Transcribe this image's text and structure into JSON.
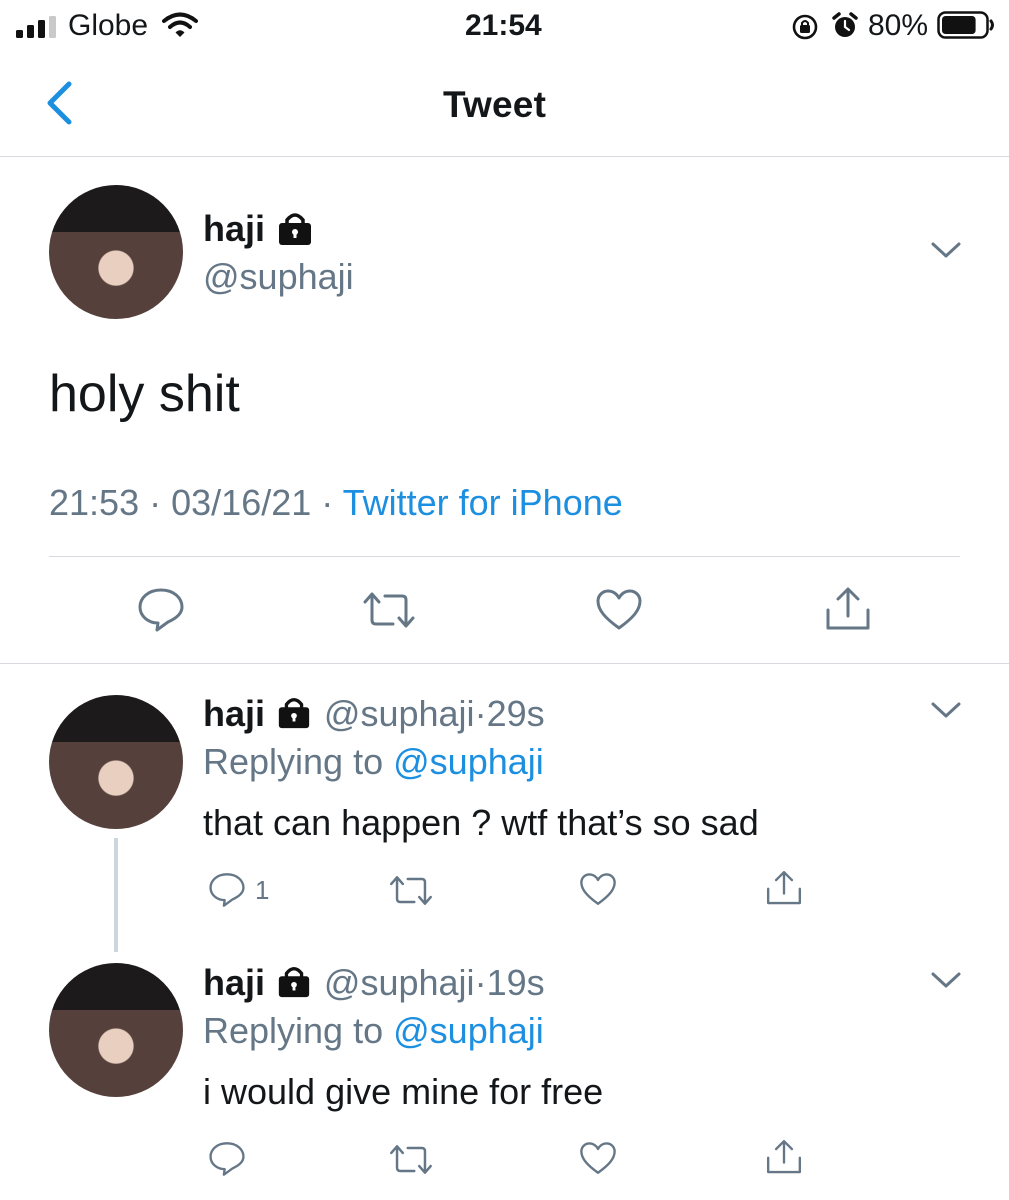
{
  "status_bar": {
    "carrier": "Globe",
    "time": "21:54",
    "battery_pct": "80%",
    "battery_level": 0.8
  },
  "nav": {
    "title": "Tweet"
  },
  "main_tweet": {
    "name": "haji",
    "handle": "@suphaji",
    "text": "holy shit",
    "time": "21:53",
    "sep1": "·",
    "date": "03/16/21",
    "sep2": "·",
    "source": "Twitter for iPhone"
  },
  "replies": [
    {
      "name": "haji",
      "handle": "@suphaji",
      "dot": "·",
      "age": "29s",
      "replying_prefix": "Replying to",
      "replying_to": "@suphaji",
      "text": "that can happen ? wtf that’s so sad",
      "reply_count": "1"
    },
    {
      "name": "haji",
      "handle": "@suphaji",
      "dot": "·",
      "age": "19s",
      "replying_prefix": "Replying to",
      "replying_to": "@suphaji",
      "text": "i would give mine for free",
      "reply_count": ""
    }
  ],
  "colors": {
    "link": "#1d8fe0",
    "muted": "#657786",
    "text": "#14171a",
    "divider": "#d6dadf",
    "thread_line": "#ccd6dd"
  },
  "icons": [
    "signal-icon",
    "wifi-icon",
    "orientation-lock-icon",
    "alarm-icon",
    "battery-icon",
    "back-chevron-icon",
    "lock-icon",
    "chevron-down-icon",
    "reply-icon",
    "retweet-icon",
    "like-icon",
    "share-icon"
  ]
}
